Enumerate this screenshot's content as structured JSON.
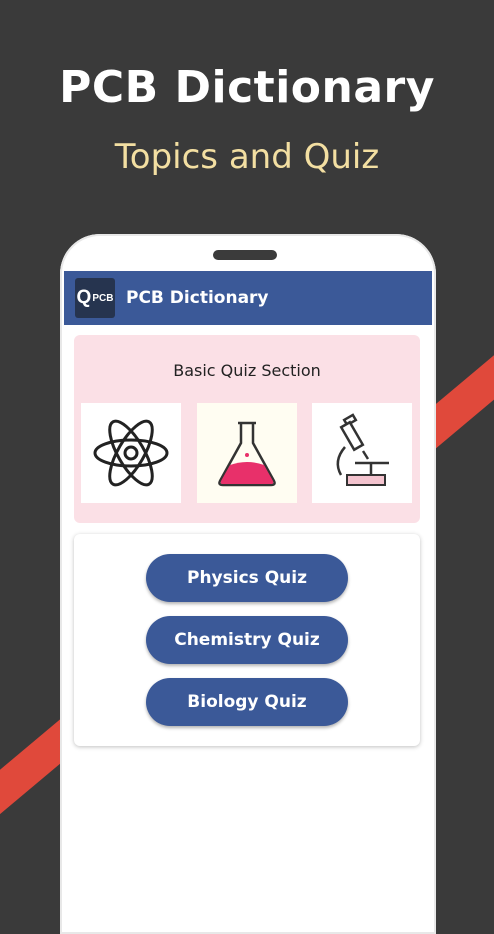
{
  "promo": {
    "title": "PCB Dictionary",
    "subtitle": "Topics and Quiz"
  },
  "appbar": {
    "logo_text": "PCB",
    "title": "PCB Dictionary"
  },
  "quiz_section": {
    "title": "Basic Quiz Section",
    "tiles": [
      {
        "icon": "atom-icon"
      },
      {
        "icon": "flask-icon"
      },
      {
        "icon": "microscope-icon"
      }
    ]
  },
  "buttons": {
    "physics": "Physics Quiz",
    "chemistry": "Chemistry Quiz",
    "biology": "Biology Quiz"
  },
  "colors": {
    "background": "#3a3a3a",
    "stripe": "#e0493b",
    "subtitle": "#f3dfa2",
    "primary": "#3b5998",
    "section_bg": "#fbe0e6"
  }
}
